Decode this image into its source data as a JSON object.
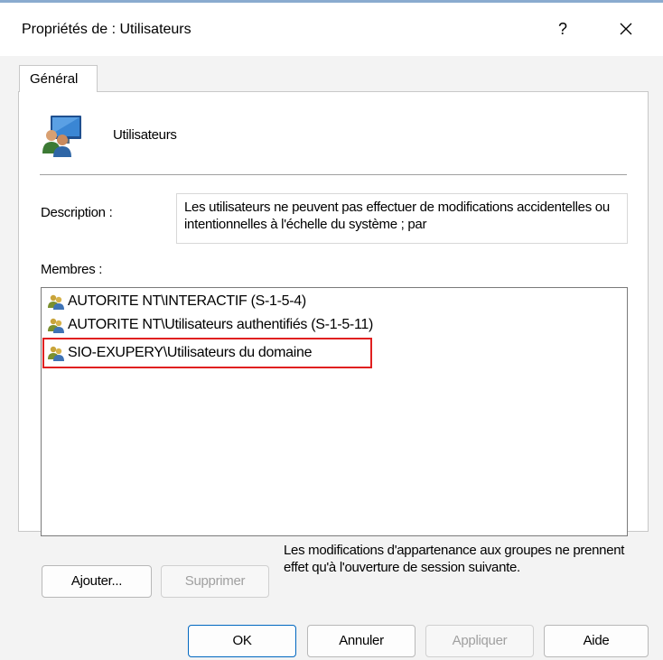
{
  "window": {
    "title": "Propriétés de : Utilisateurs",
    "help_label": "?",
    "close_label": "✕"
  },
  "tabs": [
    {
      "label": "Général",
      "active": true
    }
  ],
  "group": {
    "name": "Utilisateurs",
    "icon": "users-group-icon"
  },
  "description": {
    "label": "Description :",
    "value": "Les utilisateurs ne peuvent pas effectuer de modifications accidentelles ou intentionnelles à l'échelle du système ; par"
  },
  "members": {
    "label": "Membres :",
    "items": [
      {
        "name": "AUTORITE NT\\INTERACTIF (S-1-5-4)",
        "icon": "user-pair-icon"
      },
      {
        "name": "AUTORITE NT\\Utilisateurs authentifiés (S-1-5-11)",
        "icon": "user-pair-icon"
      },
      {
        "name": "SIO-EXUPERY\\Utilisateurs du domaine",
        "icon": "user-pair-icon",
        "highlighted": true
      }
    ]
  },
  "buttons": {
    "add": "Ajouter...",
    "remove": "Supprimer",
    "ok": "OK",
    "cancel": "Annuler",
    "apply": "Appliquer",
    "help": "Aide"
  },
  "note": "Les modifications d'appartenance aux groupes ne prennent effet qu'à l'ouverture de session suivante.",
  "colors": {
    "highlight": "#e02020",
    "accent": "#0067c0"
  }
}
